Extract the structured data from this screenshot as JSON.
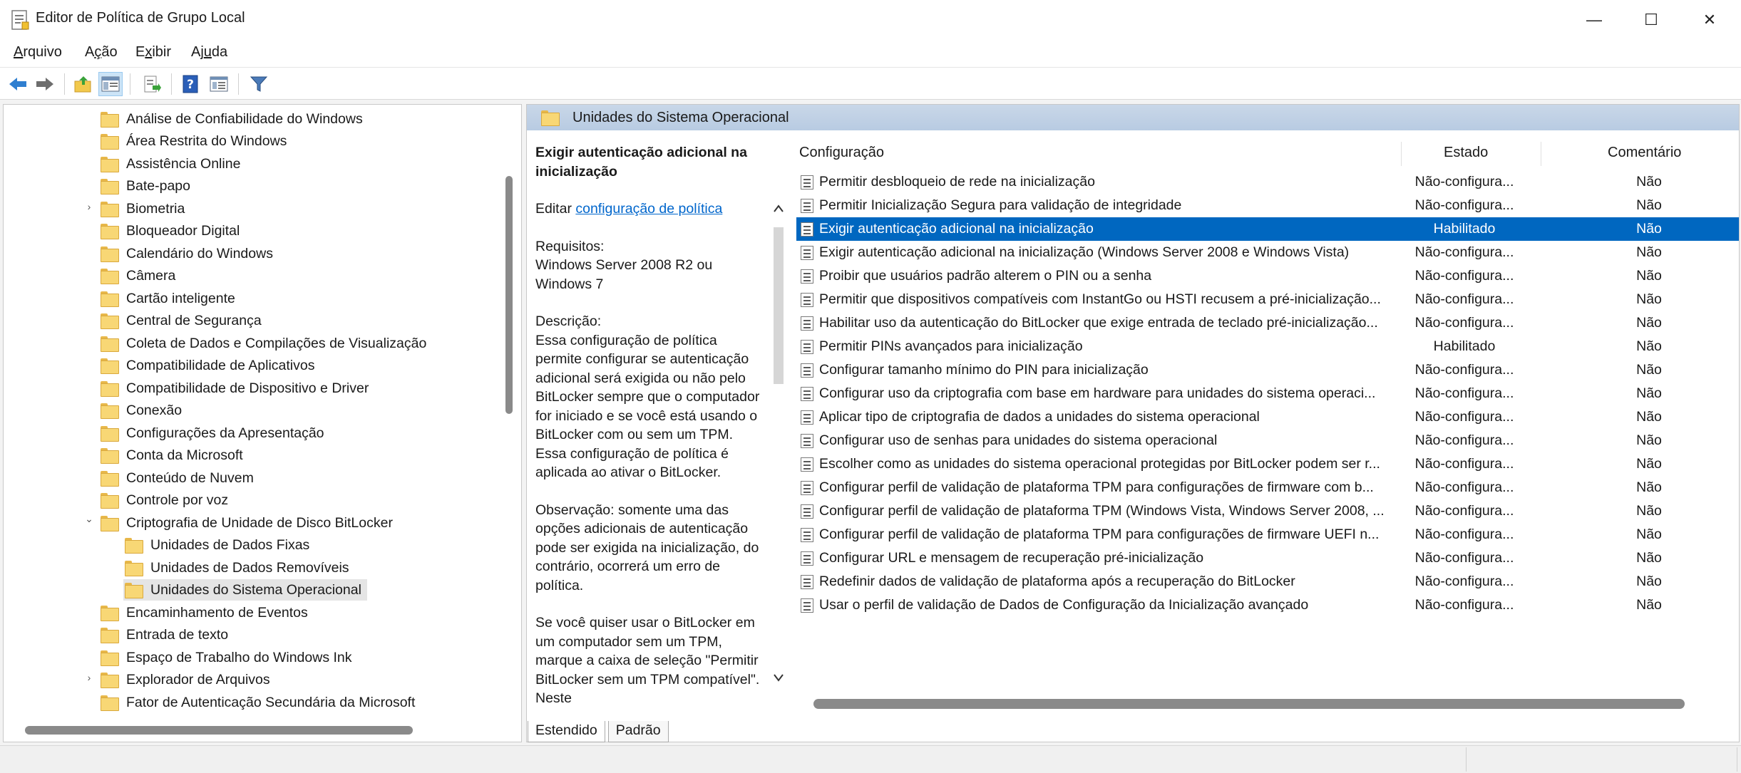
{
  "window": {
    "title": "Editor de Política de Grupo Local",
    "minimize": "—",
    "maximize": "☐",
    "close": "✕"
  },
  "menu": {
    "items": [
      {
        "hot": "A",
        "rest": "rquivo"
      },
      {
        "pre": "A",
        "hot": "ç",
        "rest": "ão"
      },
      {
        "pre": "E",
        "hot": "x",
        "rest": "ibir"
      },
      {
        "pre": "Aj",
        "hot": "u",
        "rest": "da"
      }
    ]
  },
  "toolbar": {
    "icons": [
      "back-arrow-icon",
      "forward-arrow-icon",
      "up-folder-icon",
      "show-hide-tree-icon",
      "export-list-icon",
      "help-icon",
      "properties-icon",
      "filter-icon"
    ]
  },
  "tree": {
    "items": [
      {
        "label": "Análise de Confiabilidade do Windows",
        "level": 0
      },
      {
        "label": "Área Restrita do Windows",
        "level": 0
      },
      {
        "label": "Assistência Online",
        "level": 0
      },
      {
        "label": "Bate-papo",
        "level": 0
      },
      {
        "label": "Biometria",
        "level": 0,
        "expander": "›"
      },
      {
        "label": "Bloqueador Digital",
        "level": 0
      },
      {
        "label": "Calendário do Windows",
        "level": 0
      },
      {
        "label": "Câmera",
        "level": 0
      },
      {
        "label": "Cartão inteligente",
        "level": 0
      },
      {
        "label": "Central de Segurança",
        "level": 0
      },
      {
        "label": "Coleta de Dados e Compilações de Visualização",
        "level": 0
      },
      {
        "label": "Compatibilidade de Aplicativos",
        "level": 0
      },
      {
        "label": "Compatibilidade de Dispositivo e Driver",
        "level": 0
      },
      {
        "label": "Conexão",
        "level": 0
      },
      {
        "label": "Configurações da Apresentação",
        "level": 0
      },
      {
        "label": "Conta da Microsoft",
        "level": 0
      },
      {
        "label": "Conteúdo de Nuvem",
        "level": 0
      },
      {
        "label": "Controle por voz",
        "level": 0
      },
      {
        "label": "Criptografia de Unidade de Disco BitLocker",
        "level": 0,
        "expander": "⌄"
      },
      {
        "label": "Unidades de Dados Fixas",
        "level": 1
      },
      {
        "label": "Unidades de Dados Removíveis",
        "level": 1
      },
      {
        "label": "Unidades do Sistema Operacional",
        "level": 1,
        "selected": true
      },
      {
        "label": "Encaminhamento de Eventos",
        "level": 0
      },
      {
        "label": "Entrada de texto",
        "level": 0
      },
      {
        "label": "Espaço de Trabalho do Windows Ink",
        "level": 0
      },
      {
        "label": "Explorador de Arquivos",
        "level": 0,
        "expander": "›"
      },
      {
        "label": "Fator de Autenticação Secundária da Microsoft",
        "level": 0
      }
    ]
  },
  "right": {
    "header": "Unidades do Sistema Operacional",
    "description": {
      "title": "Exigir autenticação adicional na inicialização",
      "edit_prefix": "Editar ",
      "edit_link": "configuração de política",
      "requirements_label": "Requisitos:",
      "requirements": "Windows Server 2008 R2 ou Windows 7",
      "description_label": "Descrição:",
      "description": "Essa configuração de política permite configurar se autenticação adicional será exigida ou não pelo BitLocker sempre que o computador for iniciado e se você está usando o BitLocker com ou sem um TPM. Essa configuração de política é aplicada ao ativar o BitLocker.",
      "note": "Observação: somente uma das opções adicionais de autenticação pode ser exigida na inicialização, do contrário, ocorrerá um erro de política.",
      "more": "Se você quiser usar o BitLocker em um computador sem um TPM, marque a caixa de seleção \"Permitir BitLocker sem um TPM compatível\". Neste"
    },
    "columns": {
      "config": "Configuração",
      "state": "Estado",
      "comment": "Comentário"
    },
    "rows": [
      {
        "name": "Permitir desbloqueio de rede na inicialização",
        "state": "Não-configura...",
        "comment": "Não"
      },
      {
        "name": "Permitir Inicialização Segura para validação de integridade",
        "state": "Não-configura...",
        "comment": "Não"
      },
      {
        "name": "Exigir autenticação adicional na inicialização",
        "state": "Habilitado",
        "comment": "Não",
        "selected": true
      },
      {
        "name": "Exigir autenticação adicional na inicialização (Windows Server 2008 e Windows Vista)",
        "state": "Não-configura...",
        "comment": "Não"
      },
      {
        "name": "Proibir que usuários padrão alterem o PIN ou a senha",
        "state": "Não-configura...",
        "comment": "Não"
      },
      {
        "name": "Permitir que dispositivos compatíveis com InstantGo ou HSTI recusem a pré-inicialização...",
        "state": "Não-configura...",
        "comment": "Não"
      },
      {
        "name": "Habilitar uso da autenticação do BitLocker que exige entrada de teclado pré-inicialização...",
        "state": "Não-configura...",
        "comment": "Não"
      },
      {
        "name": "Permitir PINs avançados para inicialização",
        "state": "Habilitado",
        "comment": "Não"
      },
      {
        "name": "Configurar tamanho mínimo do PIN para inicialização",
        "state": "Não-configura...",
        "comment": "Não"
      },
      {
        "name": "Configurar uso da criptografia com base em hardware para unidades do sistema operaci...",
        "state": "Não-configura...",
        "comment": "Não"
      },
      {
        "name": "Aplicar tipo de criptografia de dados a unidades do sistema operacional",
        "state": "Não-configura...",
        "comment": "Não"
      },
      {
        "name": "Configurar uso de senhas para unidades do sistema operacional",
        "state": "Não-configura...",
        "comment": "Não"
      },
      {
        "name": "Escolher como as unidades do sistema operacional protegidas por BitLocker podem ser r...",
        "state": "Não-configura...",
        "comment": "Não"
      },
      {
        "name": "Configurar perfil de validação de plataforma TPM para configurações de firmware com b...",
        "state": "Não-configura...",
        "comment": "Não"
      },
      {
        "name": "Configurar perfil de validação de plataforma TPM (Windows Vista, Windows Server 2008, ...",
        "state": "Não-configura...",
        "comment": "Não"
      },
      {
        "name": "Configurar perfil de validação de plataforma TPM para configurações de firmware UEFI n...",
        "state": "Não-configura...",
        "comment": "Não"
      },
      {
        "name": "Configurar URL e mensagem de recuperação pré-inicialização",
        "state": "Não-configura...",
        "comment": "Não"
      },
      {
        "name": "Redefinir dados de validação de plataforma após a recuperação do BitLocker",
        "state": "Não-configura...",
        "comment": "Não"
      },
      {
        "name": "Usar o perfil de validação de Dados de Configuração da Inicialização avançado",
        "state": "Não-configura...",
        "comment": "Não"
      }
    ]
  },
  "tabs": [
    "Estendido",
    "Padrão"
  ],
  "colors": {
    "selection": "#0067c0",
    "link": "#0066cc",
    "header": "#c9d7e8"
  }
}
